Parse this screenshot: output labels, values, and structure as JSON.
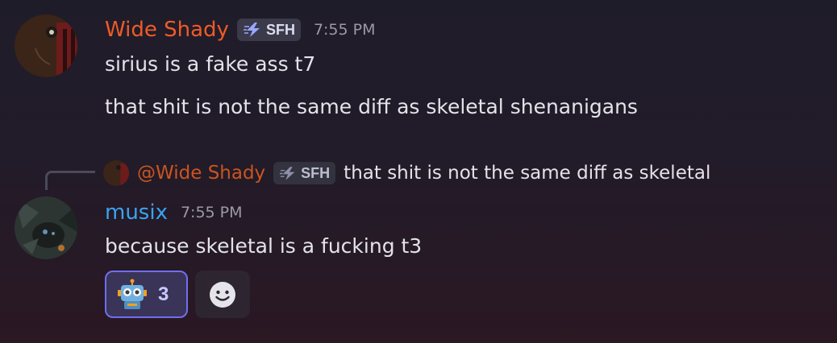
{
  "messages": [
    {
      "author": "Wide Shady",
      "tag": "SFH",
      "timestamp": "7:55 PM",
      "lines": [
        "sirius is a fake ass t7",
        "that shit is not the same diff as skeletal shenanigans"
      ]
    },
    {
      "reply": {
        "author": "@Wide Shady",
        "tag": "SFH",
        "text": "that shit is not the same diff as skeletal"
      },
      "author": "musix",
      "timestamp": "7:55 PM",
      "lines": [
        "because skeletal is a fucking t3"
      ],
      "reactions": [
        {
          "emoji": "robot-emoji",
          "count": "3",
          "selected": true
        }
      ],
      "add_reaction_icon": "smiley-add-reaction-icon"
    }
  ],
  "colors": {
    "wide_shady_name": "#ef5b26",
    "musix_name": "#3aa3f0",
    "reaction_border": "#6f6ff0",
    "background": "#221b29"
  }
}
